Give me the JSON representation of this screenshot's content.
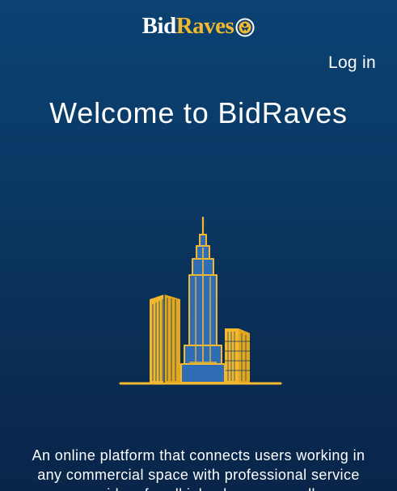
{
  "header": {
    "logo": {
      "part1": "Bid",
      "part2": "Raves",
      "badge_icon": "bidraves-badge-icon",
      "colors": {
        "part1": "#ffffff",
        "part2": "#f2b830"
      }
    },
    "login_label": "Log in"
  },
  "hero": {
    "title": "Welcome to BidRaves",
    "illustration": "city-skyline-illustration",
    "tagline": "An online platform that connects users working in any commercial space with professional service providers for all jobs, large or small."
  },
  "colors": {
    "background_top": "#0a4272",
    "background_bottom": "#09254a",
    "accent_yellow": "#f2b830",
    "building_blue": "#2f6db7"
  }
}
